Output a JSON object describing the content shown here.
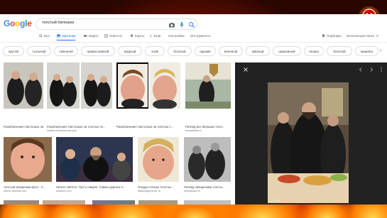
{
  "google": {
    "logo_letters": [
      {
        "ch": "G",
        "color": "#4285f4"
      },
      {
        "ch": "o",
        "color": "#ea4335"
      },
      {
        "ch": "o",
        "color": "#fbbc05"
      },
      {
        "ch": "g",
        "color": "#4285f4"
      },
      {
        "ch": "l",
        "color": "#34a853"
      },
      {
        "ch": "e",
        "color": "#ea4335"
      }
    ],
    "query": "толстый батюшка",
    "icons": [
      "camera-icon",
      "mic-icon",
      "search-icon"
    ]
  },
  "tabs": [
    {
      "label": "Все",
      "icon": "search-icon",
      "active": false
    },
    {
      "label": "Картинки",
      "icon": "image-icon",
      "active": true
    },
    {
      "label": "Видео",
      "icon": "video-icon",
      "active": false
    },
    {
      "label": "Новости",
      "icon": "news-icon",
      "active": false
    },
    {
      "label": "Карты",
      "icon": "map-pin-icon",
      "active": false
    },
    {
      "label": "Ещё",
      "icon": "more-icon",
      "active": false
    },
    {
      "label": "Настройки",
      "icon": "",
      "active": false
    },
    {
      "label": "Инструменты",
      "icon": "",
      "active": false
    }
  ],
  "right_tools": {
    "saved": "Подборки",
    "safe_search": "Безопасный поиск"
  },
  "chips": [
    "крутой",
    "тыльный",
    "смешной",
    "православный",
    "модный",
    "злой",
    "богатый",
    "оружие",
    "военный",
    "жирный",
    "церковный",
    "гелика",
    "блатной",
    "машина"
  ],
  "results": [
    {
      "caption": "Разоблачение! Настолько ли толстые...",
      "source": "masterok.livejournal.com"
    },
    {
      "caption": "Разоблачение! Настолько ли толстые св...",
      "source": "masterok.livejournal.com"
    },
    {
      "caption": "Разоблачение! Настолько ли толстые с...",
      "source": "masterok.livejournal.com"
    },
    {
      "caption": "Почему все батюшки толст...",
      "source": "senyaisitov.ru"
    },
    {
      "caption": "толстый священник фото - С...",
      "source": "meme-arsenal.com"
    },
    {
      "caption": "Ничего святого. Пусть говорят. Самых дорогих п...",
      "source": "youtube.com"
    },
    {
      "caption": "Откуда столько толстых ...",
      "source": "dailymignorance.ru"
    },
    {
      "caption": "Почему священники толсты...",
      "source": "senyaisitov.ru"
    }
  ],
  "preview": {
    "badge": "1374×875",
    "icons": [
      "close-icon",
      "prev-icon",
      "next-icon",
      "more-vert-icon"
    ]
  },
  "colors": {
    "accent": "#1a73e8",
    "preview_bg": "#222222",
    "fire": "#ff5a00"
  }
}
